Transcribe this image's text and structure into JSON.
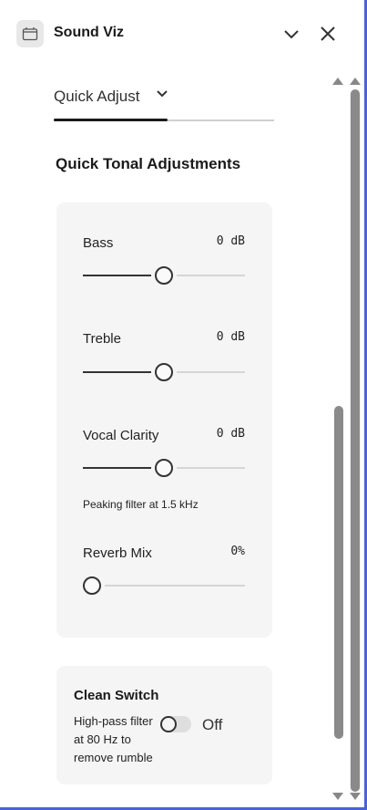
{
  "header": {
    "title": "Sound Viz",
    "app_icon": "folder-icon",
    "collapse_icon": "chevron-down-icon",
    "close_icon": "close-icon"
  },
  "tabs": {
    "active_label": "Quick Adjust",
    "dropdown_icon": "chevron-down-icon"
  },
  "section_title": "Quick Tonal Adjustments",
  "controls": [
    {
      "label": "Bass",
      "value": "0 dB",
      "level": 0.5
    },
    {
      "label": "Treble",
      "value": "0 dB",
      "level": 0.5
    },
    {
      "label": "Vocal Clarity",
      "value": "0 dB",
      "level": 0.5,
      "note": "Peaking filter at 1.5 kHz"
    },
    {
      "label": "Reverb Mix",
      "value": "0%",
      "level": 0.0
    }
  ],
  "clean_switch": {
    "title": "Clean Switch",
    "description": "High-pass filter at 80 Hz to remove rumble",
    "state": "Off"
  },
  "colors": {
    "accent_frame": "#4a63d8",
    "card_bg": "#f5f5f5",
    "scroll_thumb": "#8a8a8a"
  }
}
